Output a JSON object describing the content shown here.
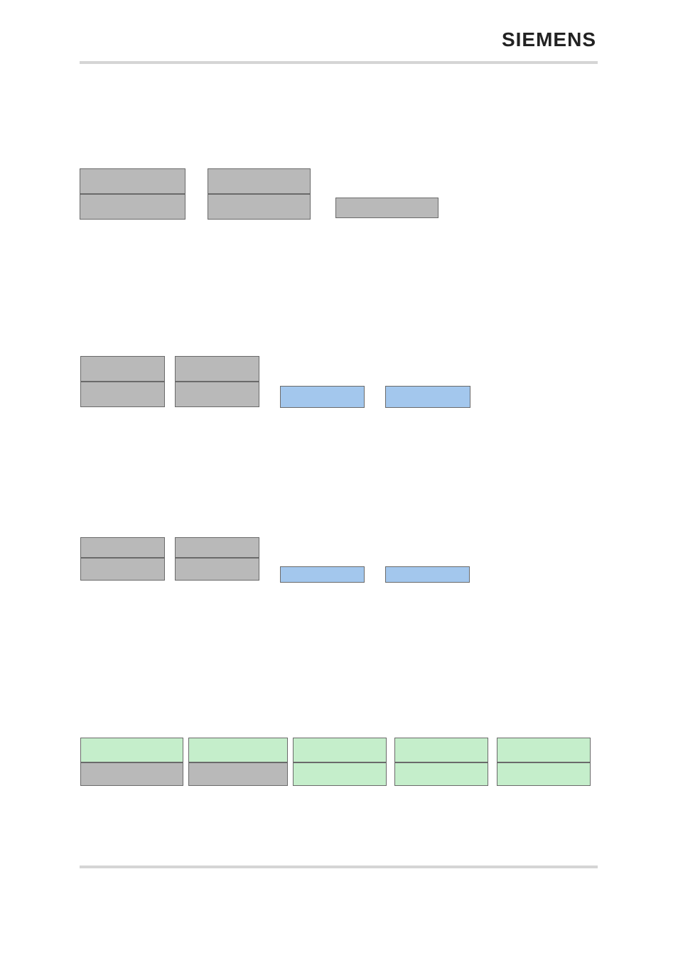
{
  "header": {
    "brand": "SIEMENS"
  },
  "colors": {
    "gray": "#b9b9b9",
    "blue": "#a3c7ed",
    "green": "#c5eecb",
    "border": "#6a6a6a",
    "divider": "#d5d5d5"
  },
  "rows": [
    {
      "id": "row-1",
      "groups": [
        {
          "type": "stack",
          "top": "gray",
          "bottom": "gray"
        },
        {
          "type": "stack",
          "top": "gray",
          "bottom": "gray"
        },
        {
          "type": "single",
          "color": "gray"
        }
      ]
    },
    {
      "id": "row-2",
      "groups": [
        {
          "type": "stack",
          "top": "gray",
          "bottom": "gray"
        },
        {
          "type": "stack",
          "top": "gray",
          "bottom": "gray"
        },
        {
          "type": "single",
          "color": "blue"
        },
        {
          "type": "single",
          "color": "blue"
        }
      ]
    },
    {
      "id": "row-3",
      "groups": [
        {
          "type": "stack",
          "top": "gray",
          "bottom": "gray"
        },
        {
          "type": "stack",
          "top": "gray",
          "bottom": "gray"
        },
        {
          "type": "single",
          "color": "blue"
        },
        {
          "type": "single",
          "color": "blue"
        }
      ]
    },
    {
      "id": "row-4",
      "groups": [
        {
          "type": "stack",
          "top": "green",
          "bottom": "gray"
        },
        {
          "type": "stack",
          "top": "green",
          "bottom": "gray"
        },
        {
          "type": "stack",
          "top": "green",
          "bottom": "green"
        },
        {
          "type": "stack",
          "top": "green",
          "bottom": "green"
        },
        {
          "type": "stack",
          "top": "green",
          "bottom": "green"
        }
      ]
    }
  ]
}
